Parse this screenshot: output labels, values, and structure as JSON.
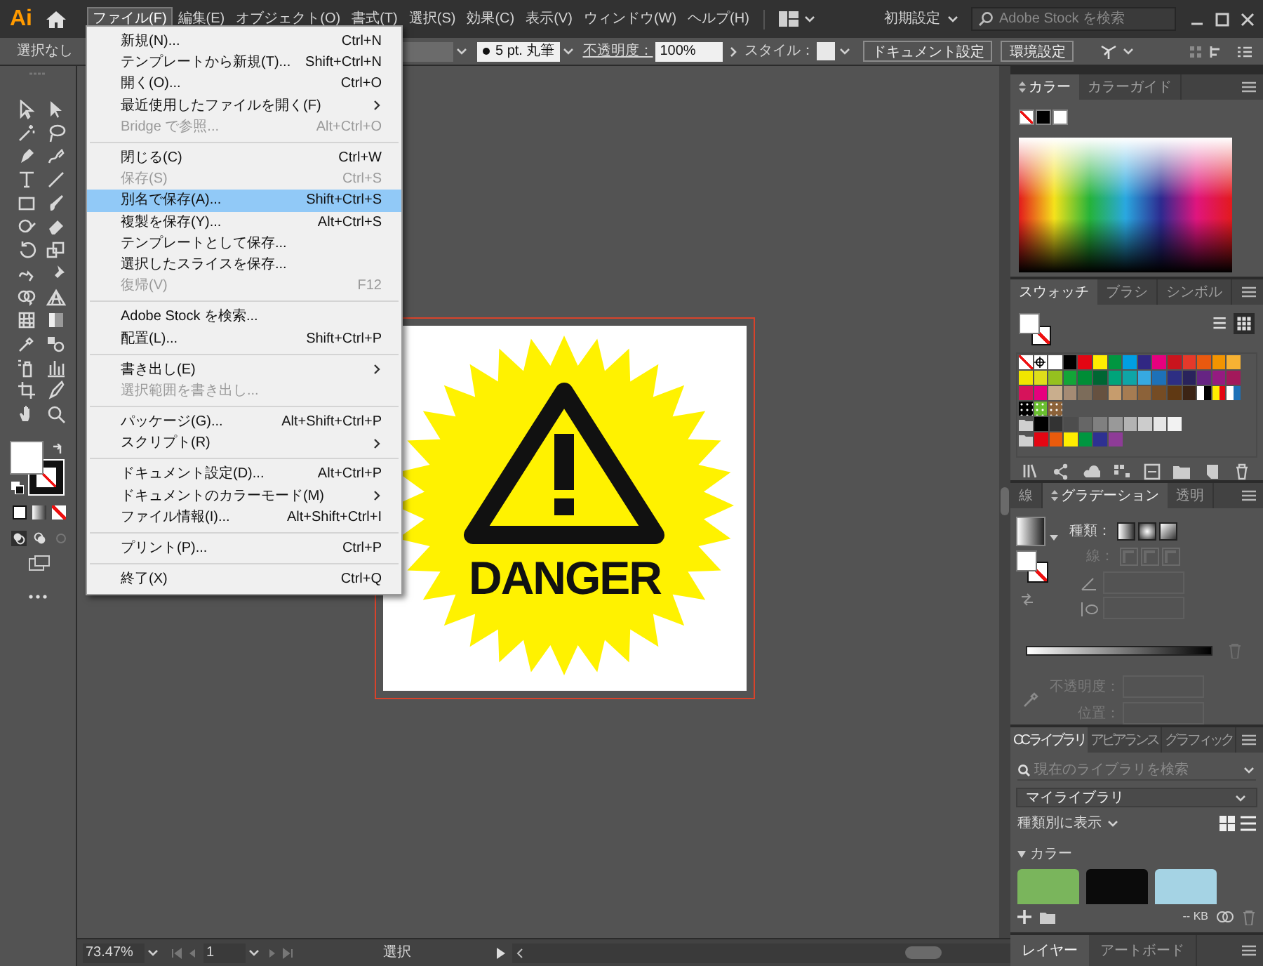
{
  "app": {
    "logo": "Ai"
  },
  "menubar": {
    "items": [
      {
        "label": "ファイル(F)",
        "selected": true
      },
      {
        "label": "編集(E)",
        "selected": false
      },
      {
        "label": "オブジェクト(O)",
        "selected": false
      },
      {
        "label": "書式(T)",
        "selected": false
      },
      {
        "label": "選択(S)",
        "selected": false
      },
      {
        "label": "効果(C)",
        "selected": false
      },
      {
        "label": "表示(V)",
        "selected": false
      },
      {
        "label": "ウィンドウ(W)",
        "selected": false
      },
      {
        "label": "ヘルプ(H)",
        "selected": false
      }
    ],
    "workspace": "初期設定",
    "search": {
      "placeholder": "Adobe Stock を検索"
    }
  },
  "control_bar": {
    "selection": "選択なし",
    "brush": "5 pt. 丸筆",
    "opacity_label": "不透明度：",
    "opacity": "100%",
    "style_label": "スタイル：",
    "buttons": [
      "ドキュメント設定",
      "環境設定"
    ]
  },
  "file_menu": {
    "groups": [
      [
        {
          "label": "新規(N)...",
          "shortcut": "Ctrl+N",
          "disabled": false,
          "selected": false,
          "submenu": false
        },
        {
          "label": "テンプレートから新規(T)...",
          "shortcut": "Shift+Ctrl+N",
          "disabled": false,
          "selected": false,
          "submenu": false
        },
        {
          "label": "開く(O)...",
          "shortcut": "Ctrl+O",
          "disabled": false,
          "selected": false,
          "submenu": false
        },
        {
          "label": "最近使用したファイルを開く(F)",
          "disabled": false,
          "selected": false,
          "submenu": true
        },
        {
          "label": "Bridge で参照...",
          "shortcut": "Alt+Ctrl+O",
          "disabled": true,
          "selected": false,
          "submenu": false
        }
      ],
      [
        {
          "label": "閉じる(C)",
          "shortcut": "Ctrl+W",
          "disabled": false,
          "selected": false,
          "submenu": false
        },
        {
          "label": "保存(S)",
          "shortcut": "Ctrl+S",
          "disabled": true,
          "selected": false,
          "submenu": false
        },
        {
          "label": "別名で保存(A)...",
          "shortcut": "Shift+Ctrl+S",
          "disabled": false,
          "selected": true,
          "submenu": false
        },
        {
          "label": "複製を保存(Y)...",
          "shortcut": "Alt+Ctrl+S",
          "disabled": false,
          "selected": false,
          "submenu": false
        },
        {
          "label": "テンプレートとして保存...",
          "disabled": false,
          "selected": false,
          "submenu": false
        },
        {
          "label": "選択したスライスを保存...",
          "disabled": false,
          "selected": false,
          "submenu": false
        },
        {
          "label": "復帰(V)",
          "shortcut": "F12",
          "disabled": true,
          "selected": false,
          "submenu": false
        }
      ],
      [
        {
          "label": "Adobe Stock を検索...",
          "disabled": false,
          "selected": false,
          "submenu": false
        },
        {
          "label": "配置(L)...",
          "shortcut": "Shift+Ctrl+P",
          "disabled": false,
          "selected": false,
          "submenu": false
        }
      ],
      [
        {
          "label": "書き出し(E)",
          "disabled": false,
          "selected": false,
          "submenu": true
        },
        {
          "label": "選択範囲を書き出し...",
          "disabled": true,
          "selected": false,
          "submenu": false
        }
      ],
      [
        {
          "label": "パッケージ(G)...",
          "shortcut": "Alt+Shift+Ctrl+P",
          "disabled": false,
          "selected": false,
          "submenu": false
        },
        {
          "label": "スクリプト(R)",
          "disabled": false,
          "selected": false,
          "submenu": true
        }
      ],
      [
        {
          "label": "ドキュメント設定(D)...",
          "shortcut": "Alt+Ctrl+P",
          "disabled": false,
          "selected": false,
          "submenu": false
        },
        {
          "label": "ドキュメントのカラーモード(M)",
          "disabled": false,
          "selected": false,
          "submenu": true
        },
        {
          "label": "ファイル情報(I)...",
          "shortcut": "Alt+Shift+Ctrl+I",
          "disabled": false,
          "selected": false,
          "submenu": false
        }
      ],
      [
        {
          "label": "プリント(P)...",
          "shortcut": "Ctrl+P",
          "disabled": false,
          "selected": false,
          "submenu": false
        }
      ],
      [
        {
          "label": "終了(X)",
          "shortcut": "Ctrl+Q",
          "disabled": false,
          "selected": false,
          "submenu": false
        }
      ]
    ]
  },
  "artboard": {
    "text": "DANGER"
  },
  "color_panel": {
    "tabs": [
      {
        "label": "カラー",
        "selected": true
      },
      {
        "label": "カラーガイド",
        "selected": false
      }
    ]
  },
  "swatches_panel": {
    "tabs": [
      {
        "label": "スウォッチ",
        "selected": true
      },
      {
        "label": "ブラシ",
        "selected": false
      },
      {
        "label": "シンボル",
        "selected": false
      }
    ],
    "view_buttons": [
      {
        "kind": "list",
        "selected": false
      },
      {
        "kind": "grid",
        "selected": true
      }
    ],
    "rows": [
      {
        "folder": false,
        "swatches": [
          {
            "kind": "none"
          },
          {
            "kind": "registration"
          },
          {
            "kind": "color",
            "color": "#ffffff"
          },
          {
            "kind": "color",
            "color": "#000000"
          },
          {
            "kind": "color",
            "color": "#e30613"
          },
          {
            "kind": "color",
            "color": "#ffed00"
          },
          {
            "kind": "color",
            "color": "#009640"
          },
          {
            "kind": "color",
            "color": "#009fe3"
          },
          {
            "kind": "color",
            "color": "#312783"
          },
          {
            "kind": "color",
            "color": "#e6007e"
          },
          {
            "kind": "color",
            "color": "#c9141d"
          },
          {
            "kind": "color",
            "color": "#e5392a"
          },
          {
            "kind": "color",
            "color": "#e9590f"
          },
          {
            "kind": "color",
            "color": "#f29400"
          },
          {
            "kind": "color",
            "color": "#f7b233"
          }
        ]
      },
      {
        "folder": false,
        "swatches": [
          {
            "kind": "color",
            "color": "#f0e500"
          },
          {
            "kind": "color",
            "color": "#dede1a"
          },
          {
            "kind": "color",
            "color": "#95c11f"
          },
          {
            "kind": "color",
            "color": "#13a538"
          },
          {
            "kind": "color",
            "color": "#008d36"
          },
          {
            "kind": "color",
            "color": "#006633"
          },
          {
            "kind": "color",
            "color": "#00a47a"
          },
          {
            "kind": "color",
            "color": "#0fa5a6"
          },
          {
            "kind": "color",
            "color": "#36a9e1"
          },
          {
            "kind": "color",
            "color": "#1d71b8"
          },
          {
            "kind": "color",
            "color": "#2d2e83"
          },
          {
            "kind": "color",
            "color": "#29235c"
          },
          {
            "kind": "color",
            "color": "#662483"
          },
          {
            "kind": "color",
            "color": "#951b81"
          },
          {
            "kind": "color",
            "color": "#a3195b"
          }
        ]
      },
      {
        "folder": false,
        "swatches": [
          {
            "kind": "color",
            "color": "#d6135b"
          },
          {
            "kind": "color",
            "color": "#e6007e"
          },
          {
            "kind": "color",
            "color": "#c9ae8d"
          },
          {
            "kind": "color",
            "color": "#a58b74"
          },
          {
            "kind": "color",
            "color": "#7c6c5a"
          },
          {
            "kind": "color",
            "color": "#665140"
          },
          {
            "kind": "color",
            "color": "#c69c6d"
          },
          {
            "kind": "color",
            "color": "#a67c52"
          },
          {
            "kind": "color",
            "color": "#8c6239"
          },
          {
            "kind": "color",
            "color": "#754c24"
          },
          {
            "kind": "color",
            "color": "#603913"
          },
          {
            "kind": "color",
            "color": "#3c2415"
          },
          {
            "kind": "gradient",
            "stops": [
              {
                "color": "#ffffff"
              },
              {
                "color": "#000000"
              }
            ]
          },
          {
            "kind": "gradient",
            "stops": [
              {
                "color": "#ffed00"
              },
              {
                "color": "#e30613"
              }
            ]
          },
          {
            "kind": "gradient",
            "stops": [
              {
                "color": "#ffffff"
              },
              {
                "color": "#1d71b8"
              }
            ]
          }
        ]
      },
      {
        "folder": false,
        "swatches": [
          {
            "kind": "pattern",
            "color": "#000000"
          },
          {
            "kind": "pattern",
            "color": "#6abf2f"
          },
          {
            "kind": "pattern",
            "color": "#8c6239"
          }
        ]
      },
      {
        "folder": true,
        "swatches": [
          {
            "kind": "color",
            "color": "#000000"
          },
          {
            "kind": "color",
            "color": "#333333"
          },
          {
            "kind": "color",
            "color": "#4d4d4d"
          },
          {
            "kind": "color",
            "color": "#666666"
          },
          {
            "kind": "color",
            "color": "#808080"
          },
          {
            "kind": "color",
            "color": "#999999"
          },
          {
            "kind": "color",
            "color": "#b3b3b3"
          },
          {
            "kind": "color",
            "color": "#cccccc"
          },
          {
            "kind": "color",
            "color": "#e6e6e6"
          },
          {
            "kind": "color",
            "color": "#f2f2f2"
          }
        ]
      },
      {
        "folder": true,
        "swatches": [
          {
            "kind": "color",
            "color": "#e30613"
          },
          {
            "kind": "color",
            "color": "#ea5b0c"
          },
          {
            "kind": "color",
            "color": "#ffed00"
          },
          {
            "kind": "color",
            "color": "#009640"
          },
          {
            "kind": "color",
            "color": "#2e3192"
          },
          {
            "kind": "color",
            "color": "#8e3c97"
          }
        ]
      }
    ]
  },
  "gradient_panel": {
    "tabs": [
      {
        "label": "線",
        "selected": false
      },
      {
        "label": "グラデーション",
        "selected": true
      },
      {
        "label": "透明",
        "selected": false
      }
    ],
    "type_label": "種類：",
    "stroke_label": "線：",
    "opacity_label": "不透明度：",
    "position_label": "位置："
  },
  "libraries_panel": {
    "tabs": [
      {
        "label": "CC ライブラリ",
        "selected": true
      },
      {
        "label": "アピアランス",
        "selected": false
      },
      {
        "label": "グラフィック",
        "selected": false
      }
    ],
    "search": {
      "placeholder": "現在のライブラリを検索"
    },
    "library": "マイライブラリ",
    "view": "種類別に表示",
    "section": "カラー",
    "colors": [
      {
        "color": "#7ab55c"
      },
      {
        "color": "#0b0b0b"
      },
      {
        "color": "#a5d3e4"
      }
    ],
    "size": "-- KB"
  },
  "bottom_tabs": [
    {
      "label": "レイヤー",
      "selected": true
    },
    {
      "label": "アートボード",
      "selected": false
    }
  ],
  "status_bar": {
    "zoom": "73.47%",
    "artboard": "1",
    "tool": "選択"
  }
}
